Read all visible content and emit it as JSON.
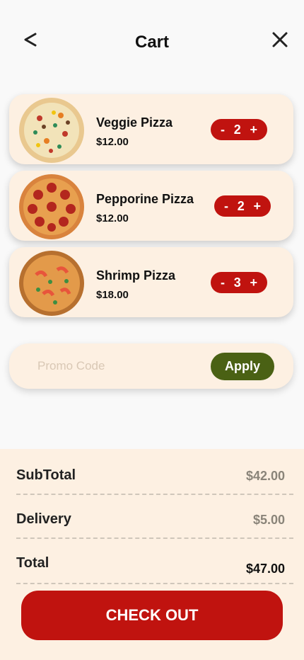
{
  "header": {
    "title": "Cart",
    "back_icon": "chevron-left-icon",
    "close_icon": "close-icon"
  },
  "cart": {
    "items": [
      {
        "name": "Veggie Pizza",
        "price": "$12.00",
        "quantity": "2",
        "minus_label": "-",
        "plus_label": "+",
        "image": "veggie-pizza-image"
      },
      {
        "name": "Pepporine Pizza",
        "price": "$12.00",
        "quantity": "2",
        "minus_label": "-",
        "plus_label": "+",
        "image": "pepperoni-pizza-image"
      },
      {
        "name": "Shrimp Pizza",
        "price": "$18.00",
        "quantity": "3",
        "minus_label": "-",
        "plus_label": "+",
        "image": "shrimp-pizza-image"
      }
    ]
  },
  "promo": {
    "placeholder": "Promo Code",
    "value": "",
    "apply_label": "Apply"
  },
  "summary": {
    "subtotal_label": "SubTotal",
    "subtotal_value": "$42.00",
    "delivery_label": "Delivery",
    "delivery_value": "$5.00",
    "total_label": "Total",
    "total_value": "$47.00"
  },
  "checkout_label": "CHECK OUT",
  "colors": {
    "accent_red": "#c0130f",
    "apply_green": "#4a6114",
    "card_bg": "#fdf0e2"
  }
}
